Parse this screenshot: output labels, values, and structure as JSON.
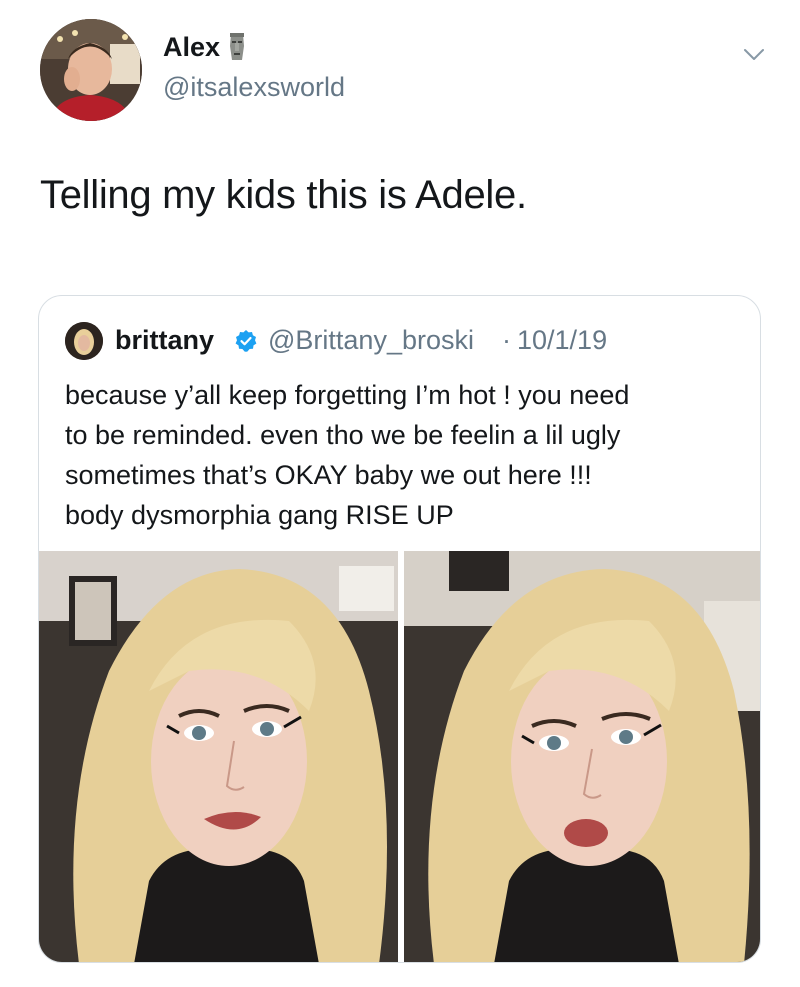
{
  "tweet": {
    "display_name": "Alex",
    "name_emoji_icon": "moai-icon",
    "handle": "@itsalexsworld",
    "text": "Telling my kids this is Adele.",
    "menu_icon": "chevron-down-icon"
  },
  "quote": {
    "name": "brittany",
    "verified_icon": "verified-badge-icon",
    "handle": "@Brittany_broski",
    "separator": "·",
    "date": "10/1/19",
    "text_lines": [
      "because y’all keep forgetting I’m hot ! you need",
      "to be reminded. even tho we be feelin a lil ugly",
      "sometimes that’s OKAY baby we out here !!!",
      "body dysmorphia gang RISE UP"
    ]
  },
  "colors": {
    "primary_text": "#14171a",
    "secondary_text": "#657786",
    "border": "#d8dee3",
    "verified": "#1da1f2"
  }
}
